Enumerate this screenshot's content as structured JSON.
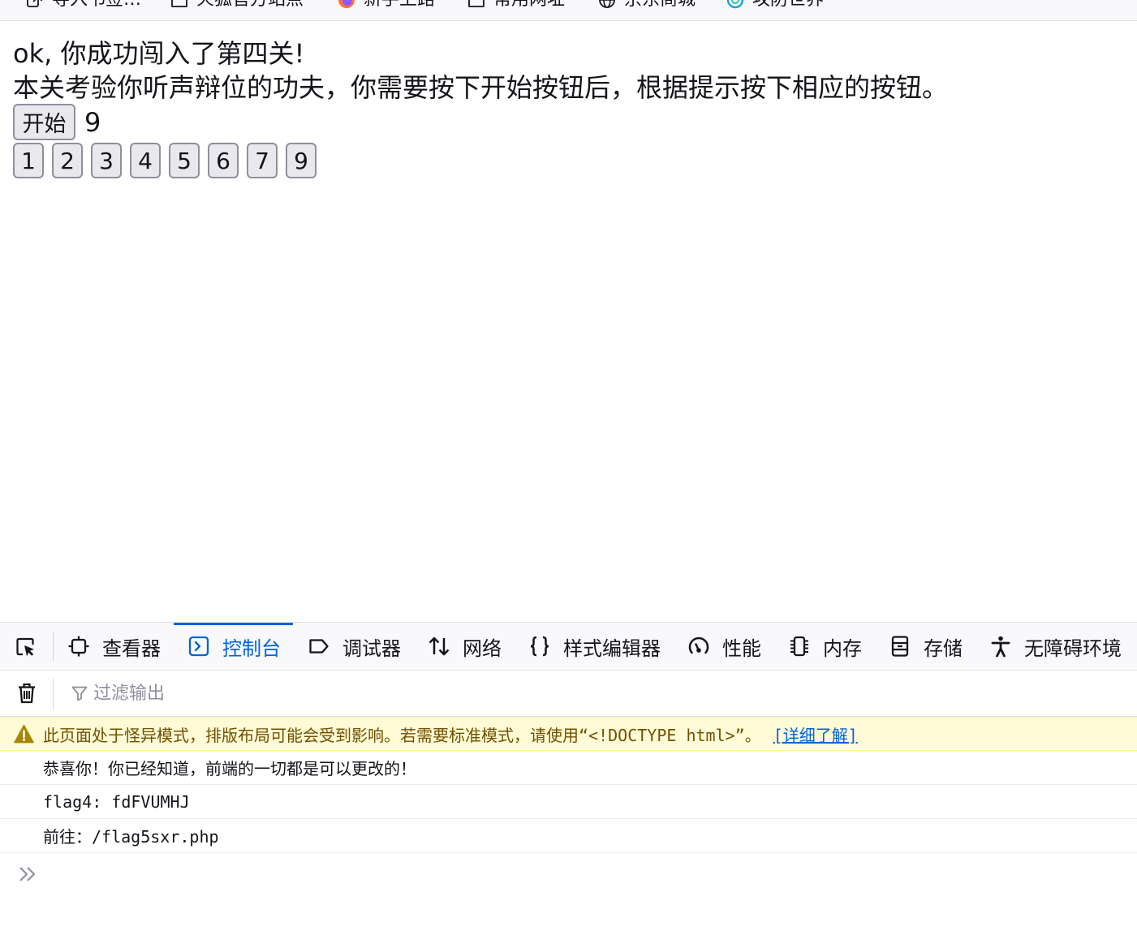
{
  "bookmarks": [
    {
      "label": "导入书签…",
      "icon": "import-icon"
    },
    {
      "label": "火狐官方站点",
      "icon": "folder-icon"
    },
    {
      "label": "新手上路",
      "icon": "firefox-logo-icon"
    },
    {
      "label": "常用网址",
      "icon": "folder-icon"
    },
    {
      "label": "京东商城",
      "icon": "globe-icon"
    },
    {
      "label": "攻防世界",
      "icon": "site-logo-icon"
    }
  ],
  "page": {
    "intro": "ok, 你成功闯入了第四关!",
    "instructions": "本关考验你听声辩位的功夫，你需要按下开始按钮后，根据提示按下相应的按钮。",
    "start_button": "开始",
    "hint": "9",
    "number_buttons": [
      "1",
      "2",
      "3",
      "4",
      "5",
      "6",
      "7",
      "9"
    ]
  },
  "devtools": {
    "picker_icon": "element-picker-icon",
    "tabs": [
      {
        "label": "查看器",
        "icon": "inspector-icon"
      },
      {
        "label": "控制台",
        "icon": "console-icon",
        "selected": true
      },
      {
        "label": "调试器",
        "icon": "debugger-icon"
      },
      {
        "label": "网络",
        "icon": "network-icon"
      },
      {
        "label": "样式编辑器",
        "icon": "style-editor-icon"
      },
      {
        "label": "性能",
        "icon": "performance-icon"
      },
      {
        "label": "内存",
        "icon": "memory-icon"
      },
      {
        "label": "存储",
        "icon": "storage-icon"
      },
      {
        "label": "无障碍环境",
        "icon": "accessibility-icon"
      }
    ],
    "filter": {
      "placeholder": "过滤输出",
      "icon": "filter-icon",
      "clear_icon": "trash-icon"
    },
    "warning": {
      "icon": "warning-icon",
      "text": "此页面处于怪异模式，排版布局可能会受到影响。若需要标准模式，请使用“<!DOCTYPE html>”。",
      "link": "[详细了解]"
    },
    "messages": [
      "恭喜你！你已经知道，前端的一切都是可以更改的！",
      "flag4: fdFVUMHJ",
      "前往：/flag5sxr.php"
    ],
    "prompt_icon": "prompt-chevrons-icon"
  },
  "colors": {
    "accent": "#0061e0",
    "warning_background": "#fffbd6",
    "warning_text": "#715100",
    "button_background": "#e9e9ed"
  }
}
